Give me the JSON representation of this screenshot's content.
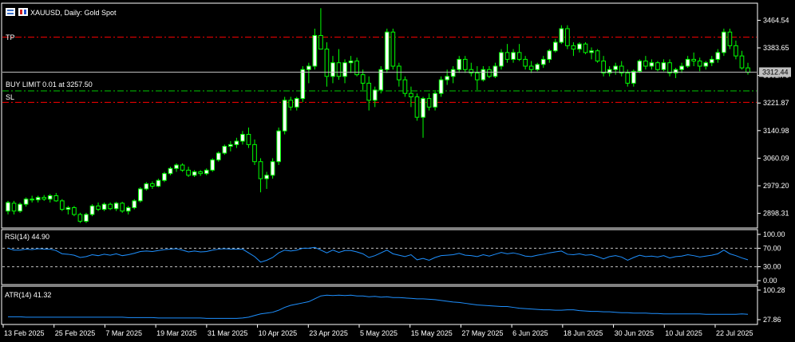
{
  "header": {
    "symbol_title": "XAUUSD, Daily:  Gold Spot"
  },
  "colors": {
    "background": "#000000",
    "frame": "#ffffff",
    "bull_fill": "#ffffff",
    "bull_outline": "#00ff00",
    "bear_fill": "#000000",
    "wick": "#00ff00",
    "indicator_line": "#1e90ff",
    "tp_sl_line": "#ff0000",
    "limit_line": "#00c800",
    "price_line": "#c0c0c0",
    "text": "#ffffff"
  },
  "orders": {
    "tp_label": "TP",
    "limit_label": "BUY LIMIT 0.01 at 3257.50",
    "sl_label": "SL",
    "tp_price": 3415,
    "limit_price": 3257.5,
    "sl_price": 3224
  },
  "current_price_label": "3312.44",
  "current_price": 3312.44,
  "price_axis": [
    "3464.54",
    "3383.65",
    "3302.76",
    "3221.87",
    "3140.98",
    "3060.09",
    "2979.20",
    "2898.31"
  ],
  "rsi": {
    "label": "RSI(14) 44.90",
    "axis": [
      "100.00",
      "70.00",
      "30.00",
      "0.00"
    ],
    "levels": [
      70,
      30
    ]
  },
  "atr": {
    "label": "ATR(14) 41.32",
    "axis": [
      "100.28",
      "27.86"
    ]
  },
  "time_axis": [
    "13 Feb 2025",
    "25 Feb 2025",
    "7 Mar 2025",
    "19 Mar 2025",
    "31 Mar 2025",
    "10 Apr 2025",
    "23 Apr 2025",
    "5 May 2025",
    "15 May 2025",
    "27 May 2025",
    "6 Jun 2025",
    "18 Jun 2025",
    "30 Jun 2025",
    "10 Jul 2025",
    "22 Jul 2025"
  ],
  "chart_data": [
    {
      "type": "candlestick",
      "title": "XAUUSD, Daily:  Gold Spot",
      "ylim": [
        2860,
        3510
      ],
      "candles": [
        [
          2905,
          2935,
          2895,
          2930
        ],
        [
          2928,
          2935,
          2895,
          2905
        ],
        [
          2905,
          2930,
          2900,
          2925
        ],
        [
          2925,
          2945,
          2918,
          2940
        ],
        [
          2940,
          2950,
          2930,
          2938
        ],
        [
          2938,
          2950,
          2930,
          2945
        ],
        [
          2945,
          2952,
          2935,
          2940
        ],
        [
          2940,
          2955,
          2930,
          2950
        ],
        [
          2950,
          2958,
          2932,
          2935
        ],
        [
          2935,
          2940,
          2905,
          2910
        ],
        [
          2910,
          2920,
          2895,
          2915
        ],
        [
          2915,
          2920,
          2890,
          2895
        ],
        [
          2895,
          2900,
          2870,
          2875
        ],
        [
          2875,
          2900,
          2870,
          2895
        ],
        [
          2895,
          2925,
          2890,
          2920
        ],
        [
          2920,
          2930,
          2905,
          2910
        ],
        [
          2910,
          2930,
          2905,
          2925
        ],
        [
          2925,
          2930,
          2908,
          2912
        ],
        [
          2912,
          2932,
          2905,
          2928
        ],
        [
          2928,
          2932,
          2900,
          2905
        ],
        [
          2905,
          2920,
          2895,
          2915
        ],
        [
          2915,
          2940,
          2910,
          2935
        ],
        [
          2935,
          2975,
          2930,
          2970
        ],
        [
          2970,
          2990,
          2965,
          2985
        ],
        [
          2985,
          2992,
          2970,
          2978
        ],
        [
          2978,
          3000,
          2975,
          2995
        ],
        [
          2995,
          3020,
          2990,
          3015
        ],
        [
          3015,
          3035,
          3010,
          3030
        ],
        [
          3030,
          3045,
          3020,
          3040
        ],
        [
          3040,
          3045,
          3020,
          3025
        ],
        [
          3025,
          3035,
          3005,
          3010
        ],
        [
          3010,
          3025,
          3005,
          3020
        ],
        [
          3020,
          3025,
          3008,
          3015
        ],
        [
          3015,
          3030,
          3010,
          3025
        ],
        [
          3025,
          3060,
          3020,
          3055
        ],
        [
          3055,
          3080,
          3050,
          3075
        ],
        [
          3075,
          3100,
          3070,
          3095
        ],
        [
          3095,
          3110,
          3080,
          3100
        ],
        [
          3100,
          3120,
          3090,
          3110
        ],
        [
          3110,
          3140,
          3100,
          3130
        ],
        [
          3130,
          3150,
          3090,
          3100
        ],
        [
          3100,
          3115,
          3040,
          3050
        ],
        [
          3050,
          3060,
          2960,
          3000
        ],
        [
          3000,
          3020,
          2970,
          3010
        ],
        [
          3010,
          3060,
          3000,
          3050
        ],
        [
          3050,
          3150,
          3040,
          3140
        ],
        [
          3140,
          3240,
          3130,
          3230
        ],
        [
          3230,
          3240,
          3200,
          3210
        ],
        [
          3210,
          3240,
          3200,
          3235
        ],
        [
          3235,
          3330,
          3225,
          3320
        ],
        [
          3320,
          3340,
          3280,
          3330
        ],
        [
          3330,
          3440,
          3320,
          3420
        ],
        [
          3420,
          3500,
          3380,
          3380
        ],
        [
          3380,
          3400,
          3270,
          3300
        ],
        [
          3300,
          3360,
          3280,
          3340
        ],
        [
          3340,
          3380,
          3290,
          3300
        ],
        [
          3300,
          3350,
          3280,
          3340
        ],
        [
          3340,
          3360,
          3310,
          3345
        ],
        [
          3345,
          3355,
          3300,
          3305
        ],
        [
          3305,
          3320,
          3260,
          3280
        ],
        [
          3280,
          3300,
          3200,
          3230
        ],
        [
          3230,
          3270,
          3210,
          3260
        ],
        [
          3260,
          3330,
          3250,
          3320
        ],
        [
          3320,
          3440,
          3310,
          3430
        ],
        [
          3430,
          3440,
          3320,
          3330
        ],
        [
          3330,
          3340,
          3270,
          3290
        ],
        [
          3290,
          3300,
          3240,
          3250
        ],
        [
          3250,
          3270,
          3210,
          3240
        ],
        [
          3240,
          3250,
          3170,
          3180
        ],
        [
          3180,
          3240,
          3120,
          3235
        ],
        [
          3235,
          3250,
          3200,
          3210
        ],
        [
          3210,
          3260,
          3200,
          3250
        ],
        [
          3250,
          3300,
          3240,
          3290
        ],
        [
          3290,
          3320,
          3275,
          3300
        ],
        [
          3300,
          3330,
          3280,
          3320
        ],
        [
          3320,
          3360,
          3310,
          3350
        ],
        [
          3350,
          3360,
          3310,
          3320
        ],
        [
          3320,
          3340,
          3300,
          3310
        ],
        [
          3310,
          3330,
          3260,
          3290
        ],
        [
          3290,
          3330,
          3285,
          3320
        ],
        [
          3320,
          3330,
          3295,
          3300
        ],
        [
          3300,
          3340,
          3295,
          3330
        ],
        [
          3330,
          3380,
          3320,
          3370
        ],
        [
          3370,
          3395,
          3340,
          3350
        ],
        [
          3350,
          3380,
          3340,
          3370
        ],
        [
          3370,
          3395,
          3345,
          3350
        ],
        [
          3350,
          3360,
          3320,
          3330
        ],
        [
          3330,
          3345,
          3310,
          3320
        ],
        [
          3320,
          3340,
          3315,
          3335
        ],
        [
          3335,
          3360,
          3325,
          3350
        ],
        [
          3350,
          3380,
          3340,
          3375
        ],
        [
          3375,
          3410,
          3370,
          3400
        ],
        [
          3400,
          3450,
          3395,
          3440
        ],
        [
          3440,
          3450,
          3380,
          3390
        ],
        [
          3390,
          3400,
          3360,
          3380
        ],
        [
          3380,
          3400,
          3370,
          3395
        ],
        [
          3395,
          3400,
          3365,
          3370
        ],
        [
          3370,
          3385,
          3350,
          3375
        ],
        [
          3375,
          3380,
          3340,
          3345
        ],
        [
          3345,
          3360,
          3300,
          3310
        ],
        [
          3310,
          3330,
          3300,
          3320
        ],
        [
          3320,
          3340,
          3305,
          3330
        ],
        [
          3330,
          3345,
          3300,
          3310
        ],
        [
          3310,
          3320,
          3270,
          3280
        ],
        [
          3280,
          3320,
          3270,
          3315
        ],
        [
          3315,
          3350,
          3310,
          3345
        ],
        [
          3345,
          3360,
          3320,
          3330
        ],
        [
          3330,
          3350,
          3320,
          3340
        ],
        [
          3340,
          3345,
          3315,
          3320
        ],
        [
          3320,
          3350,
          3315,
          3340
        ],
        [
          3340,
          3350,
          3300,
          3310
        ],
        [
          3310,
          3325,
          3295,
          3320
        ],
        [
          3320,
          3340,
          3310,
          3330
        ],
        [
          3330,
          3360,
          3325,
          3350
        ],
        [
          3350,
          3370,
          3330,
          3345
        ],
        [
          3345,
          3355,
          3315,
          3330
        ],
        [
          3330,
          3345,
          3320,
          3340
        ],
        [
          3340,
          3360,
          3330,
          3350
        ],
        [
          3350,
          3380,
          3340,
          3370
        ],
        [
          3370,
          3440,
          3360,
          3430
        ],
        [
          3430,
          3440,
          3380,
          3390
        ],
        [
          3390,
          3405,
          3350,
          3360
        ],
        [
          3360,
          3375,
          3320,
          3325
        ],
        [
          3325,
          3340,
          3305,
          3312
        ]
      ]
    },
    {
      "type": "line",
      "title": "RSI(14) 44.90",
      "ylim": [
        0,
        100
      ],
      "values": [
        70,
        66,
        66,
        68,
        67,
        69,
        68,
        68,
        65,
        58,
        57,
        55,
        50,
        52,
        56,
        54,
        57,
        55,
        58,
        54,
        56,
        59,
        63,
        64,
        63,
        65,
        67,
        68,
        69,
        66,
        62,
        64,
        62,
        63,
        66,
        68,
        69,
        68,
        68,
        68,
        60,
        52,
        40,
        44,
        50,
        60,
        66,
        64,
        66,
        70,
        70,
        72,
        66,
        60,
        66,
        61,
        65,
        65,
        62,
        58,
        50,
        54,
        60,
        66,
        58,
        55,
        52,
        56,
        45,
        48,
        44,
        50,
        54,
        55,
        56,
        59,
        55,
        54,
        52,
        56,
        53,
        57,
        61,
        58,
        60,
        57,
        53,
        52,
        55,
        57,
        60,
        62,
        64,
        57,
        56,
        58,
        55,
        56,
        52,
        47,
        52,
        54,
        51,
        44,
        50,
        55,
        52,
        53,
        51,
        54,
        49,
        52,
        53,
        56,
        54,
        51,
        53,
        55,
        58,
        66,
        58,
        54,
        49,
        45
      ]
    },
    {
      "type": "line",
      "title": "ATR(14) 41.32",
      "ylim": [
        20,
        106
      ],
      "values": [
        35,
        35,
        35,
        34,
        34,
        34,
        34,
        34,
        34,
        34,
        34,
        34,
        34,
        34,
        34,
        34,
        34,
        34,
        34,
        34,
        33,
        33,
        33,
        33,
        33,
        32,
        32,
        32,
        32,
        32,
        32,
        32,
        32,
        31,
        31,
        31,
        31,
        31,
        31,
        32,
        34,
        38,
        42,
        44,
        46,
        51,
        58,
        63,
        66,
        69,
        72,
        79,
        86,
        88,
        87,
        88,
        87,
        88,
        86,
        86,
        84,
        85,
        83,
        84,
        82,
        82,
        81,
        80,
        79,
        79,
        78,
        77,
        75,
        73,
        71,
        70,
        68,
        66,
        64,
        63,
        62,
        61,
        60,
        60,
        58,
        56,
        55,
        54,
        53,
        52,
        52,
        51,
        51,
        52,
        52,
        50,
        49,
        48,
        48,
        47,
        47,
        46,
        45,
        45,
        44,
        44,
        44,
        43,
        43,
        42,
        42,
        42,
        42,
        42,
        42,
        42,
        41,
        41,
        41,
        41,
        41,
        41,
        42,
        41
      ]
    }
  ]
}
